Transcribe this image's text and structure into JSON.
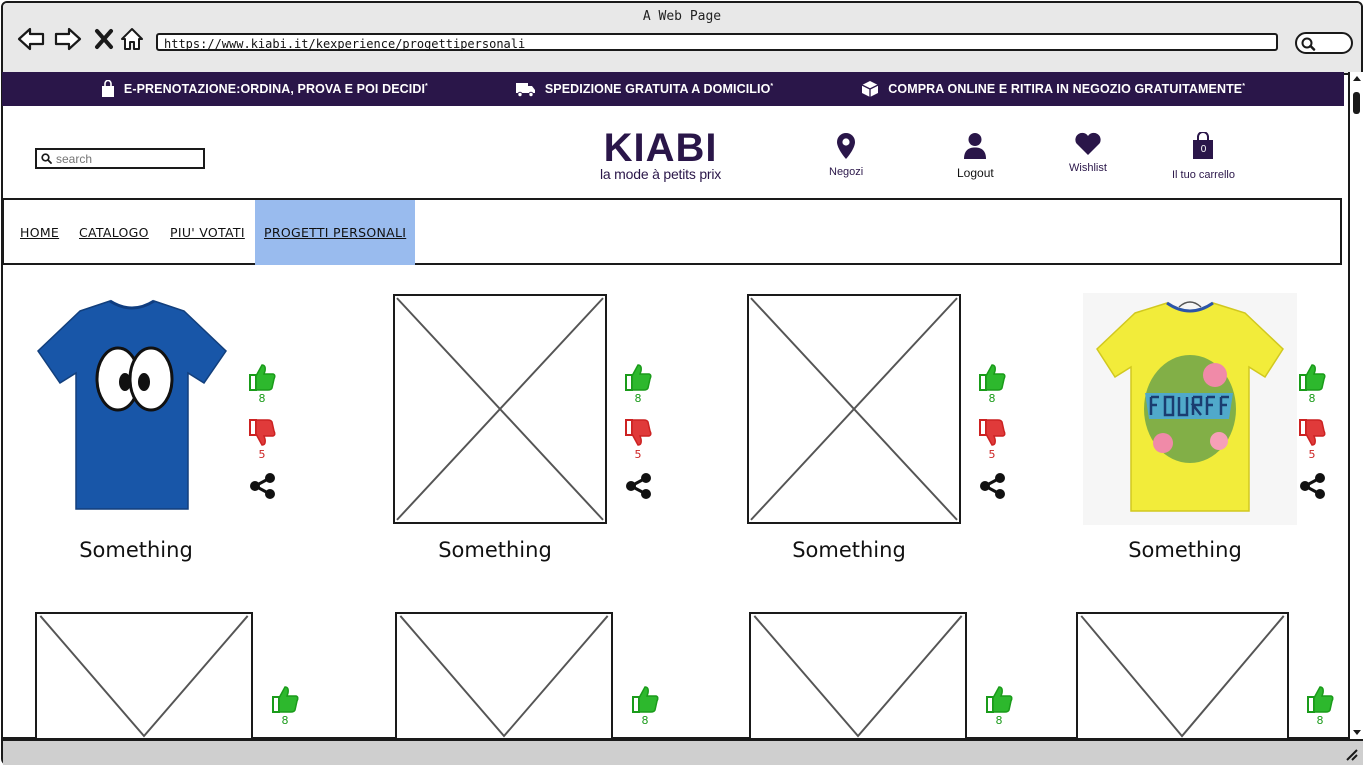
{
  "browser": {
    "title": "A Web Page",
    "url": "https://www.kiabi.it/kexperience/progettipersonali"
  },
  "promo": [
    {
      "icon": "shopping-bag-icon",
      "text": "E-PRENOTAZIONE:ORDINA, PROVA E POI DECIDI",
      "mark": "*"
    },
    {
      "icon": "truck-icon",
      "text": "SPEDIZIONE GRATUITA A DOMICILIO",
      "mark": "*"
    },
    {
      "icon": "box-icon",
      "text": "COMPRA ONLINE E RITIRA IN NEGOZIO GRATUITAMENTE",
      "mark": "*"
    }
  ],
  "header": {
    "search_placeholder": "search",
    "logo_word": "KIABI",
    "logo_tagline": "la mode à petits prix",
    "stores_label": "Negozi",
    "logout_label": "Logout",
    "wishlist_label": "Wishlist",
    "cart_label": "Il tuo carrello",
    "cart_count": "0"
  },
  "nav": {
    "tabs": [
      {
        "label": "HOME"
      },
      {
        "label": "CATALOGO"
      },
      {
        "label": "PIU' VOTATI"
      },
      {
        "label": "PROGETTI PERSONALI",
        "active": true
      }
    ]
  },
  "products": [
    {
      "title": "Something",
      "likes": "8",
      "dislikes": "5",
      "image": "blue-tshirt-eyes"
    },
    {
      "title": "Something",
      "likes": "8",
      "dislikes": "5",
      "image": "placeholder"
    },
    {
      "title": "Something",
      "likes": "8",
      "dislikes": "5",
      "image": "placeholder"
    },
    {
      "title": "Something",
      "likes": "8",
      "dislikes": "5",
      "image": "yellow-tshirt-skull"
    },
    {
      "likes": "8",
      "image": "placeholder"
    },
    {
      "likes": "8",
      "image": "placeholder"
    },
    {
      "likes": "8",
      "image": "placeholder"
    },
    {
      "likes": "8",
      "image": "placeholder"
    }
  ],
  "colors": {
    "brand": "#2a1649",
    "active_tab": "#99bbee",
    "like": "#1a9b1a",
    "dislike": "#cc2222"
  }
}
